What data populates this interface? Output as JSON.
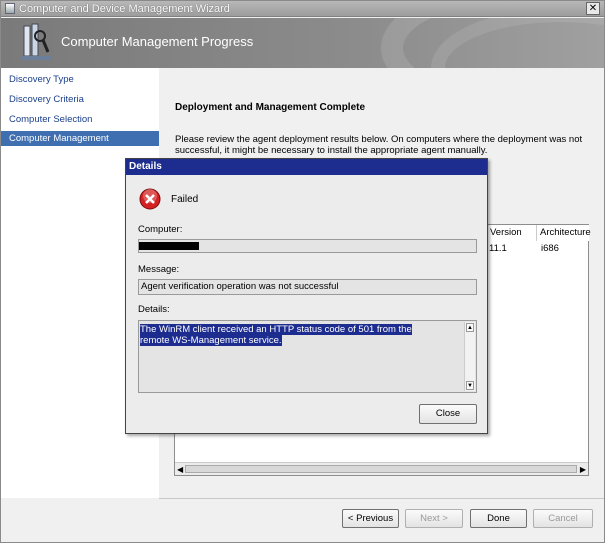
{
  "window": {
    "title": "Computer and Device Management Wizard",
    "close_glyph": "✕"
  },
  "banner": {
    "title": "Computer Management Progress",
    "icon": "wizard-tools-icon"
  },
  "sidebar": {
    "items": [
      {
        "label": "Discovery Type",
        "active": false
      },
      {
        "label": "Discovery Criteria",
        "active": false
      },
      {
        "label": "Computer Selection",
        "active": false
      },
      {
        "label": "Computer Management",
        "active": true
      }
    ]
  },
  "main": {
    "heading": "Deployment and Management Complete",
    "description": "Please review the agent deployment results below. On computers where the deployment was not successful, it might be necessary to install the appropriate agent manually.",
    "results": {
      "columns": [
        "Version",
        "Architecture"
      ],
      "rows": [
        {
          "version": "11.1",
          "architecture": "i686"
        }
      ]
    }
  },
  "footer": {
    "previous_label": "< Previous",
    "next_label": "Next >",
    "done_label": "Done",
    "cancel_label": "Cancel"
  },
  "dialog": {
    "title": "Details",
    "status": "Failed",
    "computer_label": "Computer:",
    "computer_value": "",
    "message_label": "Message:",
    "message_value": "Agent verification operation was not successful",
    "details_label": "Details:",
    "details_value": "The WinRM client received an HTTP status code of 501 from the remote WS-Management service.",
    "close_label": "Close"
  },
  "colors": {
    "title_blue": "#1d2c8f",
    "selected_nav": "#3f6fb0",
    "error_red": "#d42020"
  }
}
